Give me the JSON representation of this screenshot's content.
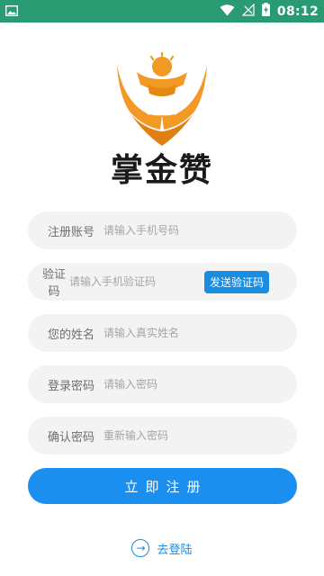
{
  "status_bar": {
    "time": "08:12",
    "icons": [
      "image-icon",
      "wifi-icon",
      "signal-icon",
      "battery-charging-icon"
    ]
  },
  "brand": {
    "name": "掌金赞",
    "logo_colors": {
      "orange": "#f29a25",
      "orange_dark": "#e07f12"
    }
  },
  "form": {
    "fields": [
      {
        "label": "注册账号",
        "placeholder": "请输入手机号码",
        "value": ""
      },
      {
        "label": "验证码",
        "placeholder": "请输入手机验证码",
        "value": "",
        "action": "发送验证码"
      },
      {
        "label": "您的姓名",
        "placeholder": "请输入真实姓名",
        "value": ""
      },
      {
        "label": "登录密码",
        "placeholder": "请输入密码",
        "value": ""
      },
      {
        "label": "确认密码",
        "placeholder": "重新输入密码",
        "value": ""
      }
    ],
    "submit_label": "立即注册"
  },
  "footer": {
    "login_label": "去登陆"
  },
  "colors": {
    "status_bar": "#2a9a73",
    "primary": "#1a8fef",
    "field_bg": "#f3f3f3"
  }
}
